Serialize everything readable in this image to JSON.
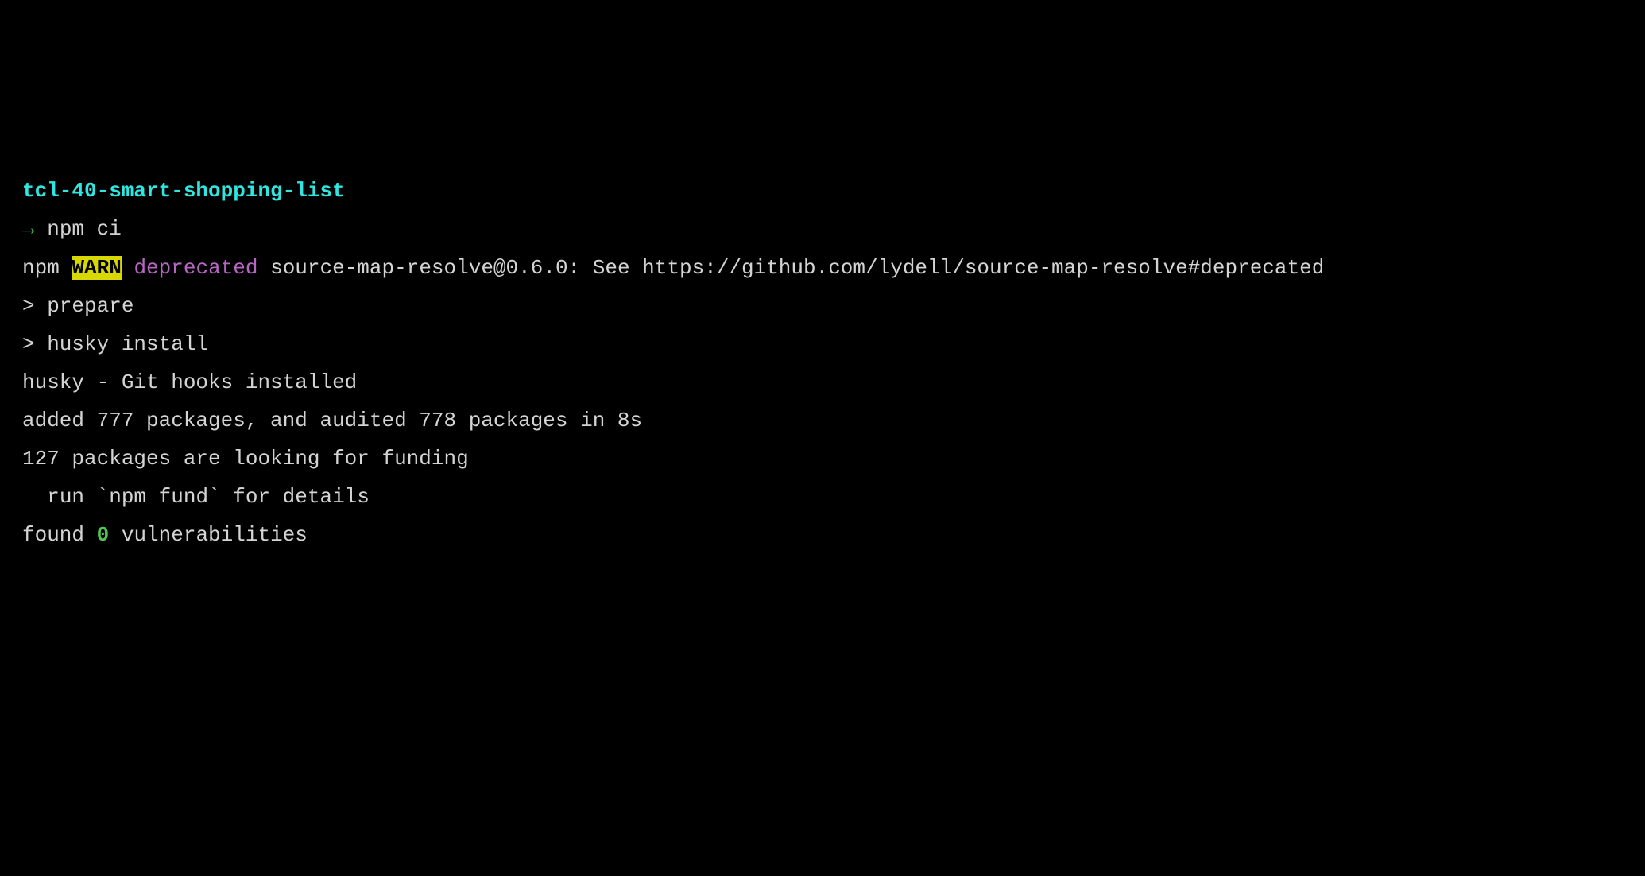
{
  "directory": "tcl-40-smart-shopping-list",
  "prompt_arrow": "→ ",
  "command": "npm ci",
  "npm_prefix": "npm ",
  "warn_label": "WARN",
  "space": " ",
  "deprecated_label": "deprecated",
  "deprecated_message": " source-map-resolve@0.6.0: See https://github.com/lydell/source-map-resolve#deprecated",
  "blank": "",
  "prepare_line": "> prepare",
  "husky_install_line": "> husky install",
  "husky_message": "husky - Git hooks installed",
  "added_message": "added 777 packages, and audited 778 packages in 8s",
  "funding_line1": "127 packages are looking for funding",
  "funding_line2": "  run `npm fund` for details",
  "found_prefix": "found ",
  "vuln_count": "0",
  "found_suffix": " vulnerabilities"
}
